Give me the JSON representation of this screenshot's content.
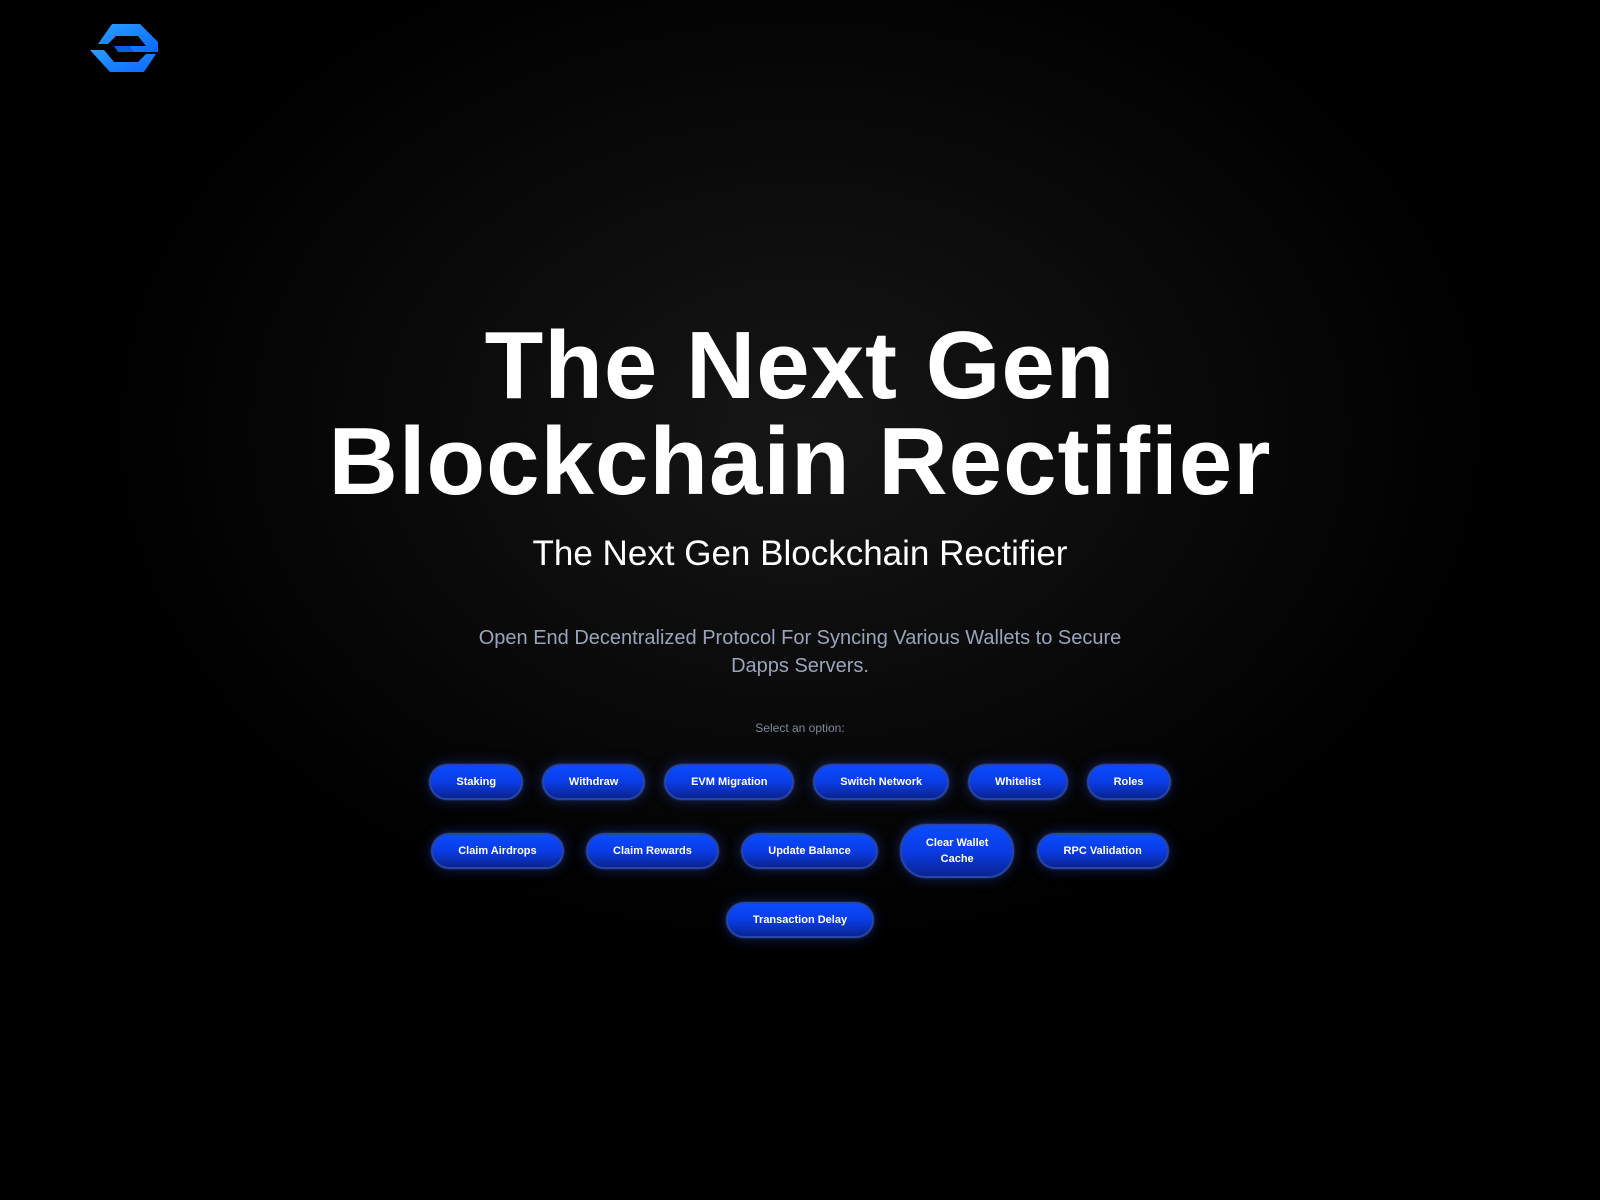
{
  "logo": {
    "icon": "brand-logo-icon",
    "colors": [
      "#1a8cff",
      "#0a5fe0"
    ]
  },
  "hero": {
    "title_line1": "The Next Gen",
    "title_line2": "Blockchain Rectifier",
    "subtitle": "The Next Gen Blockchain Rectifier",
    "description_line1": "Open End Decentralized Protocol For Syncing Various Wallets to Secure",
    "description_line2": "Dapps Servers."
  },
  "select_label": "Select an option:",
  "options": [
    {
      "label": "Staking"
    },
    {
      "label": "Withdraw"
    },
    {
      "label": "EVM Migration"
    },
    {
      "label": "Switch Network"
    },
    {
      "label": "Whitelist"
    },
    {
      "label": "Roles"
    },
    {
      "label": "Claim Airdrops"
    },
    {
      "label": "Claim Rewards"
    },
    {
      "label": "Update Balance"
    },
    {
      "label": "Clear Wallet Cache"
    },
    {
      "label": "RPC Validation"
    },
    {
      "label": "Transaction Delay"
    }
  ],
  "colors": {
    "background": "#000000",
    "button_accent": "#0a4cff",
    "button_border": "#2845a8",
    "description_text": "#9aa4bc"
  }
}
